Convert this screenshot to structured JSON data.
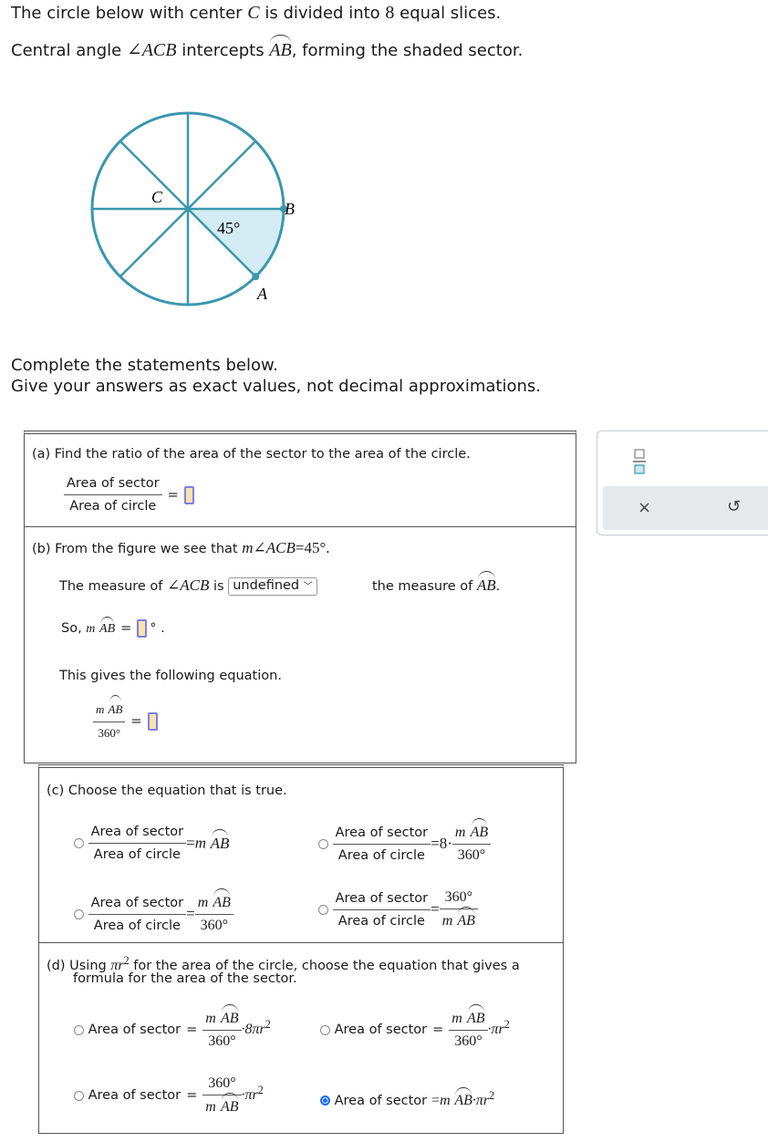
{
  "intro": {
    "line1_pre": "The circle below with center ",
    "line1_var": "C",
    "line1_mid": " is divided into ",
    "line1_num": "8",
    "line1_post": " equal slices.",
    "line2_pre": "Central angle ",
    "line2_angle": "∠ACB",
    "line2_mid": " intercepts ",
    "line2_arc": "AB",
    "line2_post": ", forming the shaded sector."
  },
  "figure": {
    "slices": 8,
    "shaded_angle_deg": 45,
    "angle_label": "45°",
    "label_center": "C",
    "label_a": "A",
    "label_b": "B",
    "stroke_color": "#3a97ad",
    "shade_color": "#d3ecf3"
  },
  "instructions": {
    "line1": "Complete the statements below.",
    "line2": "Give your answers as exact values, not decimal approximations."
  },
  "part_a": {
    "prompt": "(a) Find the ratio of the area of the sector to the area of the circle.",
    "numerator": "Area of sector",
    "denominator": "Area of circle",
    "equals": "=",
    "answer_value": ""
  },
  "part_b": {
    "prompt_pre": "(b) From the figure we see that ",
    "prompt_m": "m",
    "prompt_angle": "∠ACB",
    "prompt_post": "=45°.",
    "measure_pre": "The measure of ",
    "measure_angle": "∠ACB",
    "measure_is": " is ",
    "dropdown_value": "undefined",
    "measure_post": "the measure of ",
    "measure_arc": "AB",
    "so_pre": "So, ",
    "so_m": "m",
    "so_arc": "AB",
    "so_eq": "=",
    "degree": "°",
    "period": ".",
    "gives": "This gives the following equation.",
    "eq_num_m": "m",
    "eq_num_arc": "AB",
    "eq_den": "360°",
    "equals": "="
  },
  "part_c": {
    "prompt": "(c) Choose the equation that is true.",
    "num": "Area of sector",
    "den": "Area of circle",
    "options": [
      {
        "rhs": "=m AB",
        "selected": false
      },
      {
        "rhs": "=8·(m AB / 360°)",
        "selected": false
      },
      {
        "rhs": "=(m AB / 360°)",
        "selected": false
      },
      {
        "rhs": "=(360° / m AB)",
        "selected": false
      }
    ],
    "m": "m",
    "arc": "AB",
    "deg360": "360°",
    "eight": "8·",
    "eq": "="
  },
  "part_d": {
    "prompt_pre": "(d) Using ",
    "prompt_pi": "πr",
    "prompt_exp": "2",
    "prompt_post": " for the area of the circle, choose the equation that gives a",
    "prompt_line2": "formula for the area of the sector.",
    "lhs": "Area of sector",
    "eq": "=",
    "m": "m",
    "arc": "AB",
    "deg360": "360°",
    "pi8": "·8πr",
    "pi": "·πr",
    "exp": "2",
    "options": [
      {
        "rhs": "(m AB / 360°)·8πr²",
        "selected": false
      },
      {
        "rhs": "(m AB / 360°)·πr²",
        "selected": false
      },
      {
        "rhs": "(360° / m AB)·πr²",
        "selected": false
      },
      {
        "rhs": "m AB·πr²",
        "selected": true
      }
    ]
  },
  "tool_panel": {
    "fraction_tool": "fraction-template",
    "clear_label": "×",
    "undo_label": "↺"
  }
}
